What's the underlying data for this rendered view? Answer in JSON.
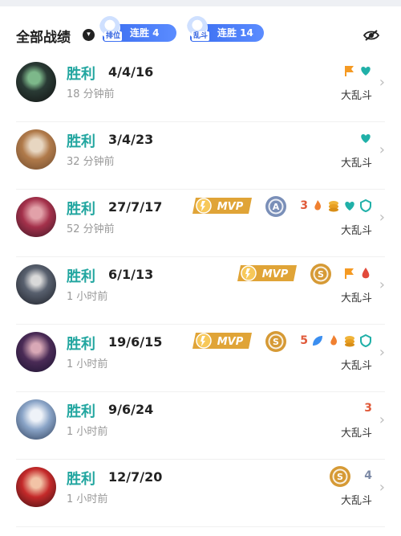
{
  "header": {
    "title": "全部战绩",
    "badges": [
      {
        "tag": "排位",
        "label": "连胜 4"
      },
      {
        "tag": "乱斗",
        "label": "连胜 14"
      }
    ]
  },
  "colors": {
    "win": "#22a6a0",
    "mvp": "#e0a437",
    "grade_a": "#7a8fb8",
    "grade_s": "#d69a35",
    "streak_badge": "#3a6df0"
  },
  "matches": [
    {
      "result": "胜利",
      "kda": "4/4/16",
      "time": "18 分钟前",
      "mode": "大乱斗",
      "mvp": false,
      "grade": "",
      "icons": [
        "flag-icon",
        "heart-icon"
      ],
      "count": ""
    },
    {
      "result": "胜利",
      "kda": "3/4/23",
      "time": "32 分钟前",
      "mode": "大乱斗",
      "mvp": false,
      "grade": "",
      "icons": [
        "heart-icon"
      ],
      "count": ""
    },
    {
      "result": "胜利",
      "kda": "27/7/17",
      "time": "52 分钟前",
      "mode": "大乱斗",
      "mvp": true,
      "mvp_label": "MVP",
      "grade": "A",
      "icons": [
        "flame-icon",
        "coin-icon",
        "heart-icon",
        "shield-icon"
      ],
      "count": "3"
    },
    {
      "result": "胜利",
      "kda": "6/1/13",
      "time": "1 小时前",
      "mode": "大乱斗",
      "mvp": true,
      "mvp_label": "MVP",
      "grade": "S",
      "icons": [
        "flag-icon",
        "drop-icon"
      ],
      "count": ""
    },
    {
      "result": "胜利",
      "kda": "19/6/15",
      "time": "1 小时前",
      "mode": "大乱斗",
      "mvp": true,
      "mvp_label": "MVP",
      "grade": "S",
      "icons": [
        "leaf-icon",
        "flame-icon",
        "coin-icon",
        "shield-icon"
      ],
      "count": "5"
    },
    {
      "result": "胜利",
      "kda": "9/6/24",
      "time": "1 小时前",
      "mode": "大乱斗",
      "mvp": false,
      "grade": "",
      "icons": [],
      "count": "3"
    },
    {
      "result": "胜利",
      "kda": "12/7/20",
      "time": "1 小时前",
      "mode": "大乱斗",
      "mvp": false,
      "grade": "S",
      "icons": [],
      "count": "4"
    }
  ]
}
